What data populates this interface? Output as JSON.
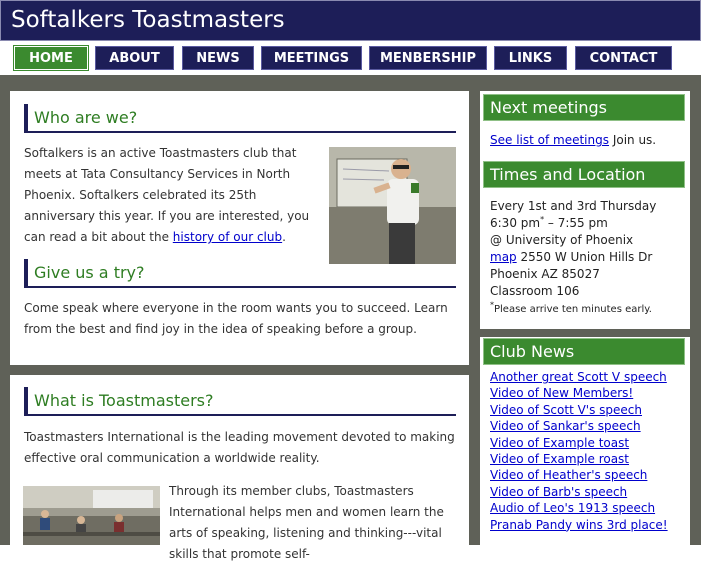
{
  "site": {
    "title": "Softalkers Toastmasters"
  },
  "nav": [
    {
      "label": "HOME",
      "active": true
    },
    {
      "label": "ABOUT"
    },
    {
      "label": "NEWS"
    },
    {
      "label": "MEETINGS"
    },
    {
      "label": "MENBERSHIP"
    },
    {
      "label": "LINKS"
    },
    {
      "label": "CONTACT"
    }
  ],
  "who": {
    "heading": "Who are we?",
    "text": "Softalkers is an active Toastmasters club that meets at Tata Consultancy Services in North Phoenix. Softalkers celebrated its 25th anniversary this year. If you are interested, you can read a bit about the ",
    "link": "history of our club",
    "end": "."
  },
  "try": {
    "heading": "Give us a try?",
    "text": "Come speak where everyone in the room wants you to succeed. Learn from the best and find joy in the idea of speaking before a group."
  },
  "what": {
    "heading": "What is Toastmasters?",
    "text": "Toastmasters International is the leading movement devoted to making effective oral communication a worldwide reality.",
    "text2": "Through its member clubs, Toastmasters International helps men and women learn the arts of speaking, listening and thinking---vital skills that promote self-"
  },
  "next_meetings": {
    "heading": "Next meetings",
    "link": "See list of meetings",
    "text": " Join us."
  },
  "times": {
    "heading": "Times and Location",
    "line1": "Every 1st and 3rd Thursday",
    "line2a": "6:30 pm",
    "line2star": "*",
    "line2b": " – 7:55 pm",
    "line3": "@ University of Phoenix",
    "map_link": "map",
    "line4": " 2550 W Union Hills Dr",
    "line5": "Phoenix AZ 85027",
    "line6": "Classroom 106",
    "note_star": "*",
    "note": "Please arrive ten minutes early."
  },
  "news": {
    "heading": "Club News",
    "items": [
      "Another great Scott V speech",
      "Video of New Members!",
      "Video of Scott V's speech",
      "Video of Sankar's speech",
      "Video of Example toast",
      "Video of Example roast",
      "Video of Heather's speech",
      "Video of Barb's speech",
      "Audio of Leo's 1913 speech",
      "Pranab Pandy wins 3rd place!"
    ]
  },
  "colors": {
    "header_bg": "#1d1e58",
    "accent_green": "#3b8a2f",
    "heading_green": "#2e7d22",
    "page_bg": "#5f6158",
    "link": "#0000cc"
  }
}
